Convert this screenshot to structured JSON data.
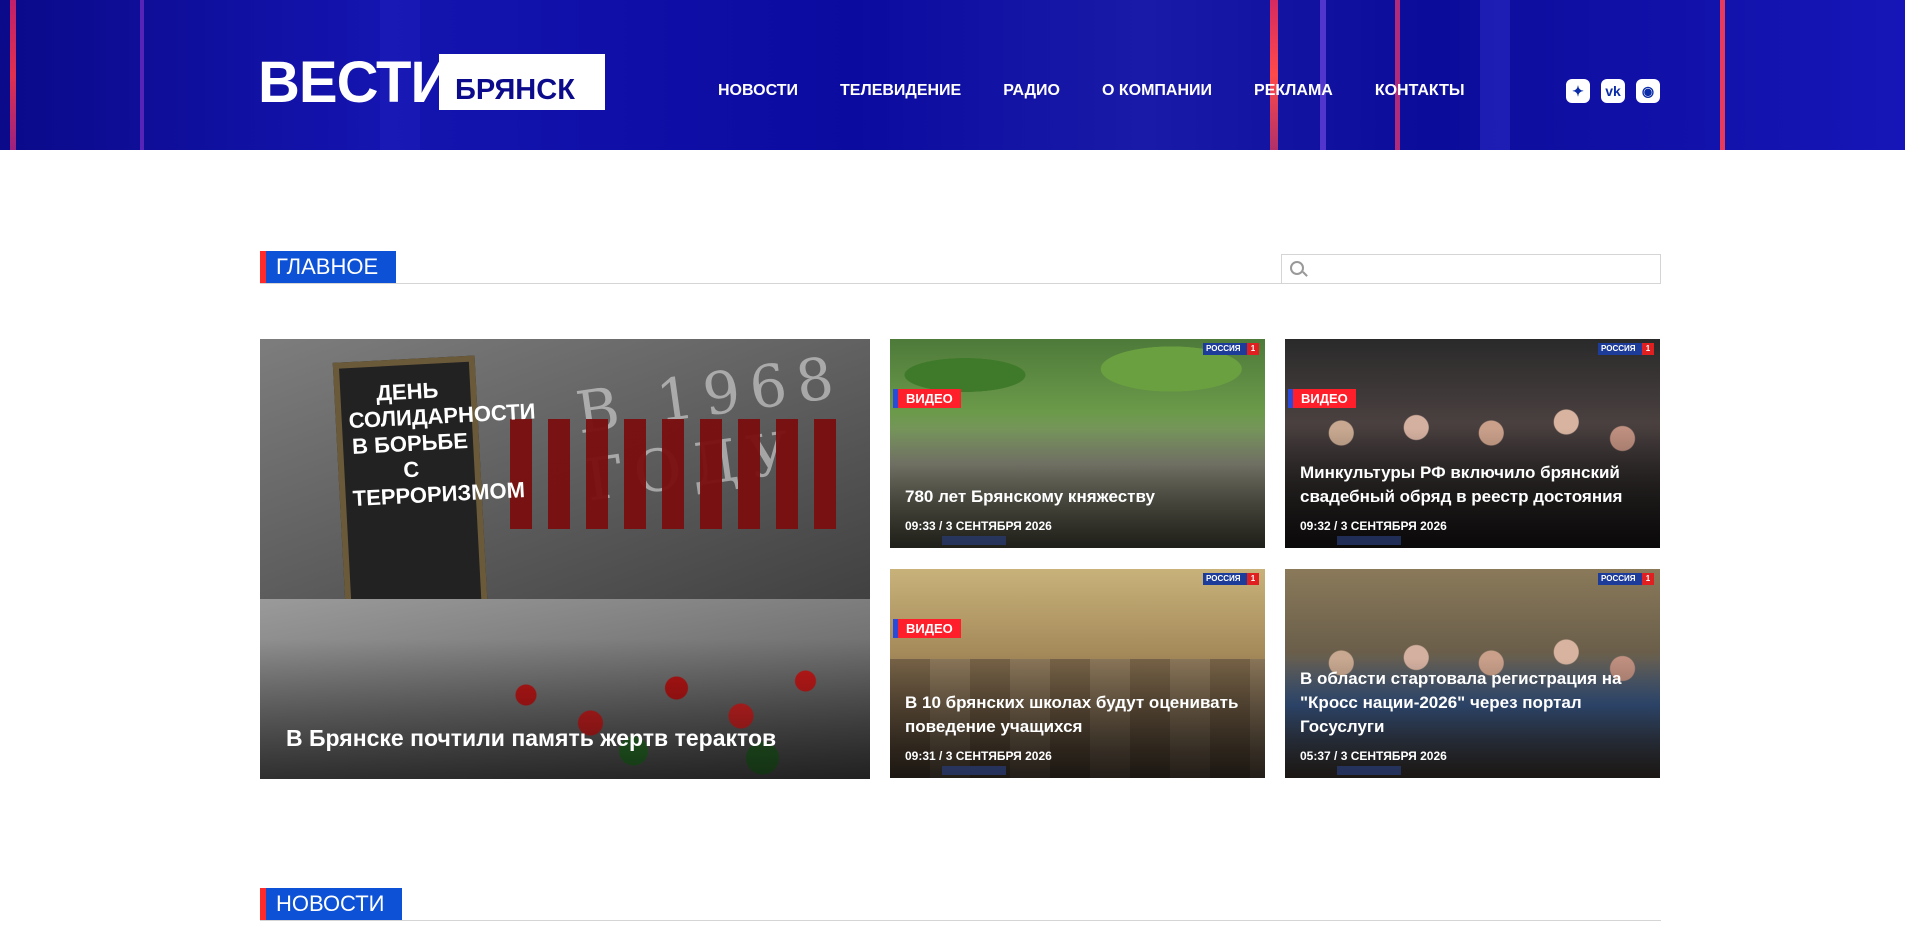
{
  "header": {
    "logo_main": "ВЕСТИ",
    "logo_region": "БРЯНСК",
    "nav": [
      "НОВОСТИ",
      "ТЕЛЕВИДЕНИЕ",
      "РАДИО",
      "О КОМПАНИИ",
      "РЕКЛАМА",
      "КОНТАКТЫ"
    ],
    "social": [
      {
        "icon": "star-icon",
        "glyph": "✦"
      },
      {
        "icon": "vk-icon",
        "glyph": "vk"
      },
      {
        "icon": "app-icon",
        "glyph": "◉"
      }
    ],
    "colors": {
      "background": "#0b0b9c",
      "accent": "#e0304f"
    }
  },
  "sections": {
    "main_label": "ГЛАВНОЕ",
    "news_label": "НОВОСТИ"
  },
  "search": {
    "placeholder": ""
  },
  "channel": {
    "name": "РОССИЯ"
  },
  "featured": {
    "title": "В Брянске почтили память жертв терактов",
    "poster_text": "ДЕНЬ СОЛИДАРНОСТИ В БОРЬБЕ С ТЕРРОРИЗМОМ",
    "wall_text": "В 1968 ГОДУ"
  },
  "cards": [
    {
      "badge": "ВИДЕО",
      "title": "780 лет Брянскому княжеству",
      "date": "09:33 / 3 СЕНТЯБРЯ 2026"
    },
    {
      "badge": "ВИДЕО",
      "title": "Минкультуры РФ включило брянский свадебный обряд в реестр достояния",
      "date": "09:32 / 3 СЕНТЯБРЯ 2026"
    },
    {
      "badge": "ВИДЕО",
      "title": "В 10 брянских школах будут оценивать поведение учащихся",
      "date": "09:31 / 3 СЕНТЯБРЯ 2026"
    },
    {
      "badge": "",
      "title": "В области стартовала регистрация на \"Кросс нации-2026\" через портал Госуслуги",
      "date": "05:37 / 3 СЕНТЯБРЯ 2026"
    }
  ]
}
